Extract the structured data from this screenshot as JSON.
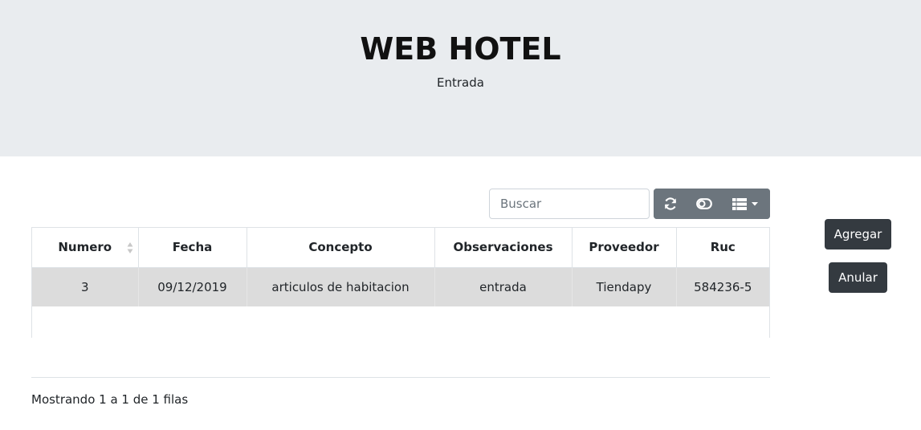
{
  "header": {
    "title": "WEB HOTEL",
    "subtitle": "Entrada"
  },
  "toolbar": {
    "search_placeholder": "Buscar",
    "icons": [
      "refresh-icon",
      "toggle-icon",
      "columns-icon",
      "caret-down-icon"
    ]
  },
  "table": {
    "columns": [
      "Numero",
      "Fecha",
      "Concepto",
      "Observaciones",
      "Proveedor",
      "Ruc"
    ],
    "rows": [
      [
        "3",
        "09/12/2019",
        "articulos de habitacion",
        "entrada",
        "Tiendapy",
        "584236-5"
      ]
    ]
  },
  "pagination": {
    "info": "Mostrando 1 a 1 de 1 filas"
  },
  "actions": {
    "add_label": "Agregar",
    "cancel_label": "Anular"
  },
  "colors": {
    "jumbotron_bg": "#e9ecef",
    "toolbar_btn": "#6c757d",
    "dark_btn": "#343a40",
    "row_highlight": "#dcdcdc"
  }
}
